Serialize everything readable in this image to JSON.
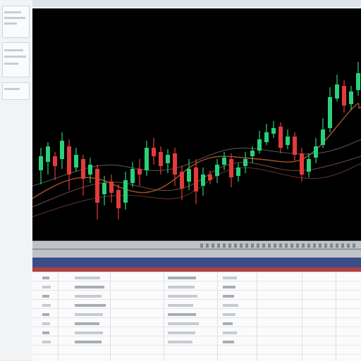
{
  "window": {
    "title": ""
  },
  "chart": {
    "type": "candlestick",
    "background": "#000000",
    "up_color": "#29d17a",
    "down_color": "#e33b3b",
    "ma_colors": [
      "#b55a2a",
      "#8f5f55",
      "#6e6e6e",
      "#7c3f3f"
    ]
  },
  "status_bar": {
    "accent": "#8f969f"
  },
  "table": {
    "rows": 9,
    "columns": 8
  }
}
